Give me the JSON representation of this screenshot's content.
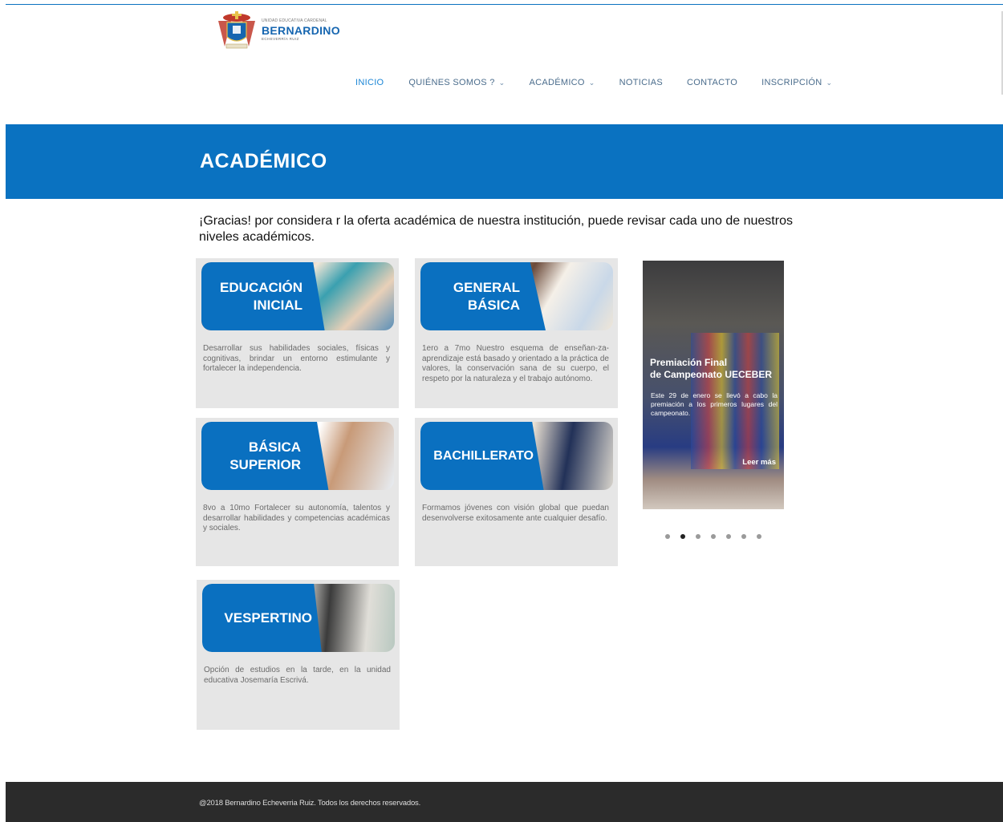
{
  "logo": {
    "top_text": "UNIDAD EDUCATIVA CARDENAL",
    "main_text": "BERNARDINO",
    "sub_text": "ECHEVERRÍA RUIZ"
  },
  "nav": {
    "items": [
      {
        "label": "INICIO",
        "active": true,
        "dropdown": false
      },
      {
        "label": "QUIÉNES SOMOS ?",
        "active": false,
        "dropdown": true
      },
      {
        "label": "ACADÉMICO",
        "active": false,
        "dropdown": true
      },
      {
        "label": "NOTICIAS",
        "active": false,
        "dropdown": false
      },
      {
        "label": "CONTACTO",
        "active": false,
        "dropdown": false
      },
      {
        "label": "INSCRIPCIÓN",
        "active": false,
        "dropdown": true
      }
    ],
    "dropdown_icon": "chevron-down-icon"
  },
  "banner": {
    "title": "ACADÉMICO"
  },
  "intro": "¡Gracias! por considera r la oferta académica de nuestra institución, puede revisar cada uno de nuestros niveles académicos.",
  "cards": [
    {
      "title_line1": "EDUCACIÓN",
      "title_line2": "INICIAL",
      "desc": "Desarrollar sus habilidades sociales, físicas y cognitivas, brindar un entorno estimulante y fortalecer la independencia."
    },
    {
      "title_line1": "GENERAL",
      "title_line2": "BÁSICA",
      "desc": "1ero a 7mo Nuestro esquema de enseñan-za-aprendizaje está basado y orientado a la práctica de valores, la conservación sana de su cuerpo, el respeto por la naturaleza y el trabajo autónomo."
    },
    {
      "title_line1": "BÁSICA",
      "title_line2": "SUPERIOR",
      "desc": "8vo a 10mo Fortalecer su autonomía, talentos y desarrollar habilidades y competencias académicas y sociales."
    },
    {
      "title_line1": "BACHILLERATO",
      "title_line2": "",
      "desc": "Formamos jóvenes con visión global que puedan desenvolverse exitosamente ante cualquier desafío."
    },
    {
      "title_line1": "VESPERTINO",
      "title_line2": "",
      "desc": "Opción de estudios en la tarde, en la unidad educativa Josemaría Escrivá."
    }
  ],
  "slider": {
    "title_line1": "Premiación Final",
    "title_line2": "de Campeonato UECEBER",
    "text": "Este 29 de enero se llevó a cabo la premiación a los primeros lugares del campeonato.",
    "more_label": "Leer más",
    "dot_count": 7,
    "active_dot": 2
  },
  "footer": {
    "text": "@2018 Bernardino Echeverria Ruiz. Todos los derechos reservados."
  },
  "colors": {
    "brand_blue": "#0a72c1",
    "footer_bg": "#2b2b2b",
    "card_bg": "#e6e6e6",
    "nav_active": "#1b86d6"
  }
}
